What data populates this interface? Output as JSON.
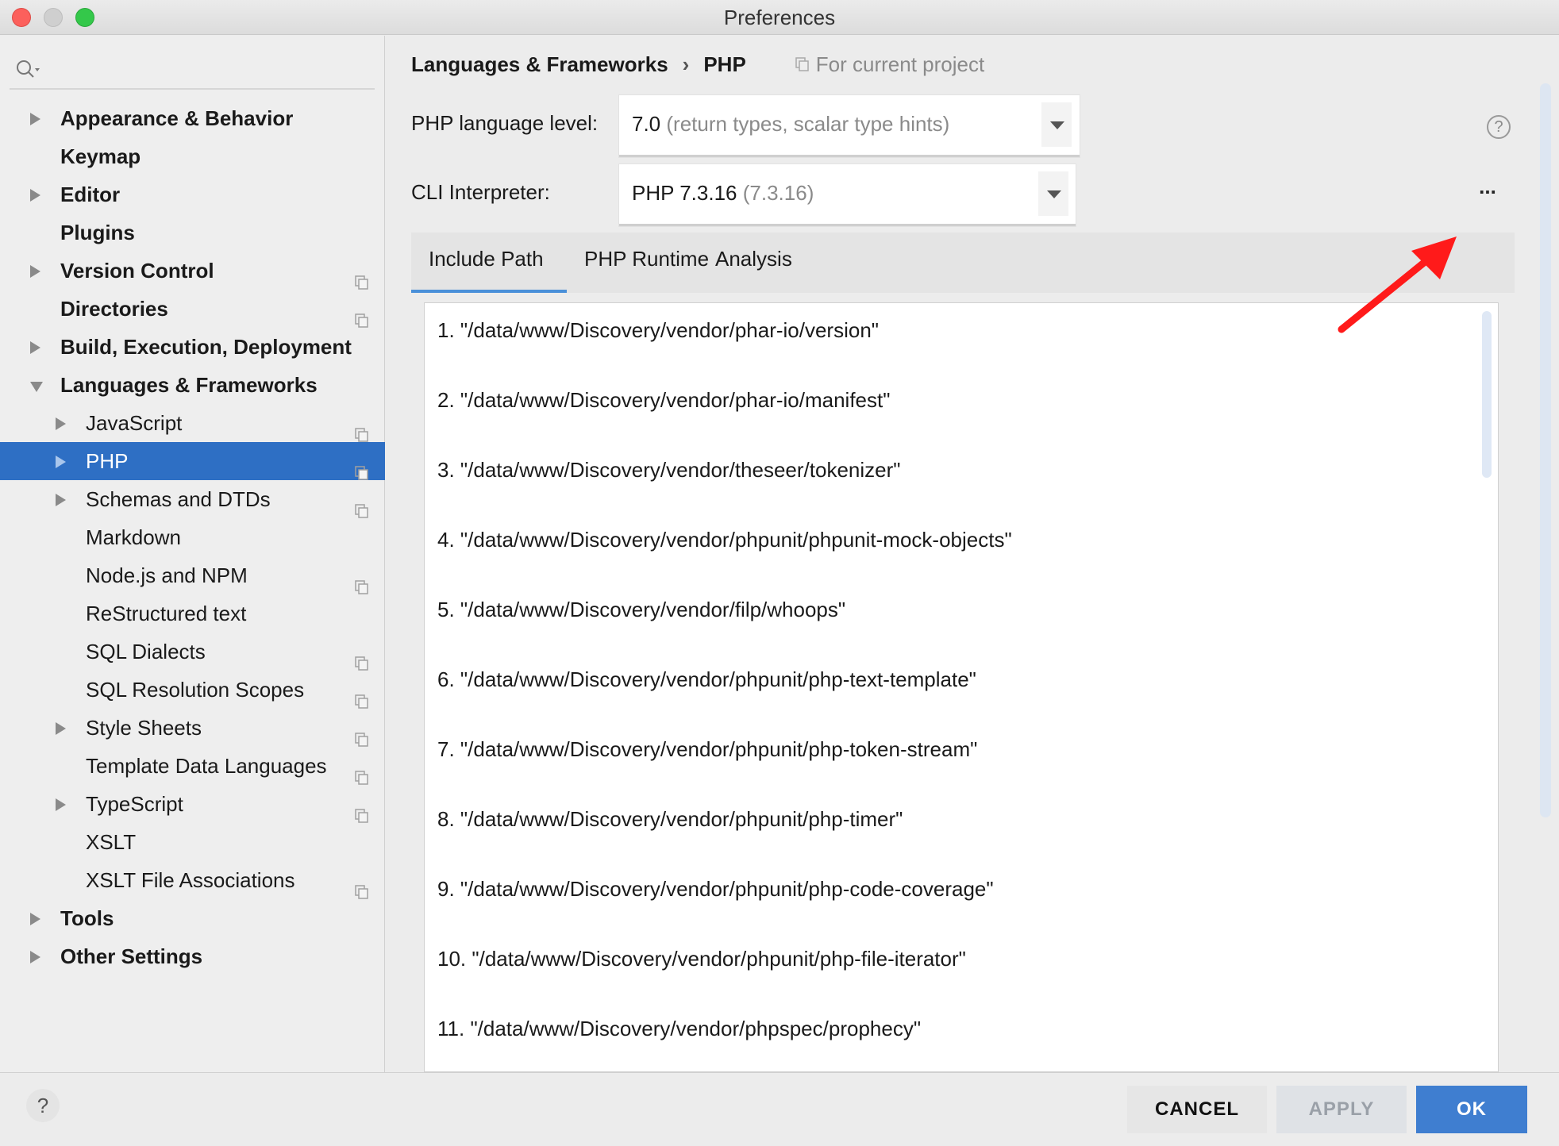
{
  "window": {
    "title": "Preferences"
  },
  "sidebar": {
    "search_placeholder": "",
    "items": [
      {
        "label": "Appearance & Behavior",
        "level": 0,
        "expand": "collapsed",
        "project": false
      },
      {
        "label": "Keymap",
        "level": 0,
        "expand": "none",
        "project": false
      },
      {
        "label": "Editor",
        "level": 0,
        "expand": "collapsed",
        "project": false
      },
      {
        "label": "Plugins",
        "level": 0,
        "expand": "none",
        "project": false
      },
      {
        "label": "Version Control",
        "level": 0,
        "expand": "collapsed",
        "project": true
      },
      {
        "label": "Directories",
        "level": 0,
        "expand": "none",
        "project": true
      },
      {
        "label": "Build, Execution, Deployment",
        "level": 0,
        "expand": "collapsed",
        "project": false
      },
      {
        "label": "Languages & Frameworks",
        "level": 0,
        "expand": "expanded",
        "project": false
      },
      {
        "label": "JavaScript",
        "level": 1,
        "expand": "collapsed",
        "project": true
      },
      {
        "label": "PHP",
        "level": 1,
        "expand": "collapsed",
        "project": true,
        "selected": true
      },
      {
        "label": "Schemas and DTDs",
        "level": 1,
        "expand": "collapsed",
        "project": true
      },
      {
        "label": "Markdown",
        "level": 1,
        "expand": "none",
        "project": false
      },
      {
        "label": "Node.js and NPM",
        "level": 1,
        "expand": "none",
        "project": true
      },
      {
        "label": "ReStructured text",
        "level": 1,
        "expand": "none",
        "project": false
      },
      {
        "label": "SQL Dialects",
        "level": 1,
        "expand": "none",
        "project": true
      },
      {
        "label": "SQL Resolution Scopes",
        "level": 1,
        "expand": "none",
        "project": true
      },
      {
        "label": "Style Sheets",
        "level": 1,
        "expand": "collapsed",
        "project": true
      },
      {
        "label": "Template Data Languages",
        "level": 1,
        "expand": "none",
        "project": true
      },
      {
        "label": "TypeScript",
        "level": 1,
        "expand": "collapsed",
        "project": true
      },
      {
        "label": "XSLT",
        "level": 1,
        "expand": "none",
        "project": false
      },
      {
        "label": "XSLT File Associations",
        "level": 1,
        "expand": "none",
        "project": true
      },
      {
        "label": "Tools",
        "level": 0,
        "expand": "collapsed",
        "project": false
      },
      {
        "label": "Other Settings",
        "level": 0,
        "expand": "collapsed",
        "project": false
      }
    ]
  },
  "breadcrumb": {
    "parent": "Languages & Frameworks",
    "separator": "›",
    "current": "PHP",
    "scope": "For current project"
  },
  "php": {
    "level_label": "PHP language level:",
    "level_value": "7.0",
    "level_hint": "(return types, scalar type hints)",
    "cli_label": "CLI Interpreter:",
    "cli_value": "PHP 7.3.16",
    "cli_hint": "(7.3.16)",
    "help": "?",
    "more": "..."
  },
  "tabs": [
    {
      "label": "Include Path",
      "active": true
    },
    {
      "label": "PHP Runtime",
      "active": false
    },
    {
      "label": "Analysis",
      "active": false
    }
  ],
  "include_paths": [
    "1. \"/data/www/Discovery/vendor/phar-io/version\"",
    "2. \"/data/www/Discovery/vendor/phar-io/manifest\"",
    "3. \"/data/www/Discovery/vendor/theseer/tokenizer\"",
    "4. \"/data/www/Discovery/vendor/phpunit/phpunit-mock-objects\"",
    "5. \"/data/www/Discovery/vendor/filp/whoops\"",
    "6. \"/data/www/Discovery/vendor/phpunit/php-text-template\"",
    "7. \"/data/www/Discovery/vendor/phpunit/php-token-stream\"",
    "8. \"/data/www/Discovery/vendor/phpunit/php-timer\"",
    "9. \"/data/www/Discovery/vendor/phpunit/php-code-coverage\"",
    "10. \"/data/www/Discovery/vendor/phpunit/php-file-iterator\"",
    "11. \"/data/www/Discovery/vendor/phpspec/prophecy\""
  ],
  "footer": {
    "help": "?",
    "cancel": "CANCEL",
    "apply": "APPLY",
    "ok": "OK"
  },
  "colors": {
    "selection": "#2e6fc4",
    "ok_button": "#3f7ed0",
    "annotation_arrow": "#ff1a1a",
    "tab_underline": "#4a90d9"
  }
}
